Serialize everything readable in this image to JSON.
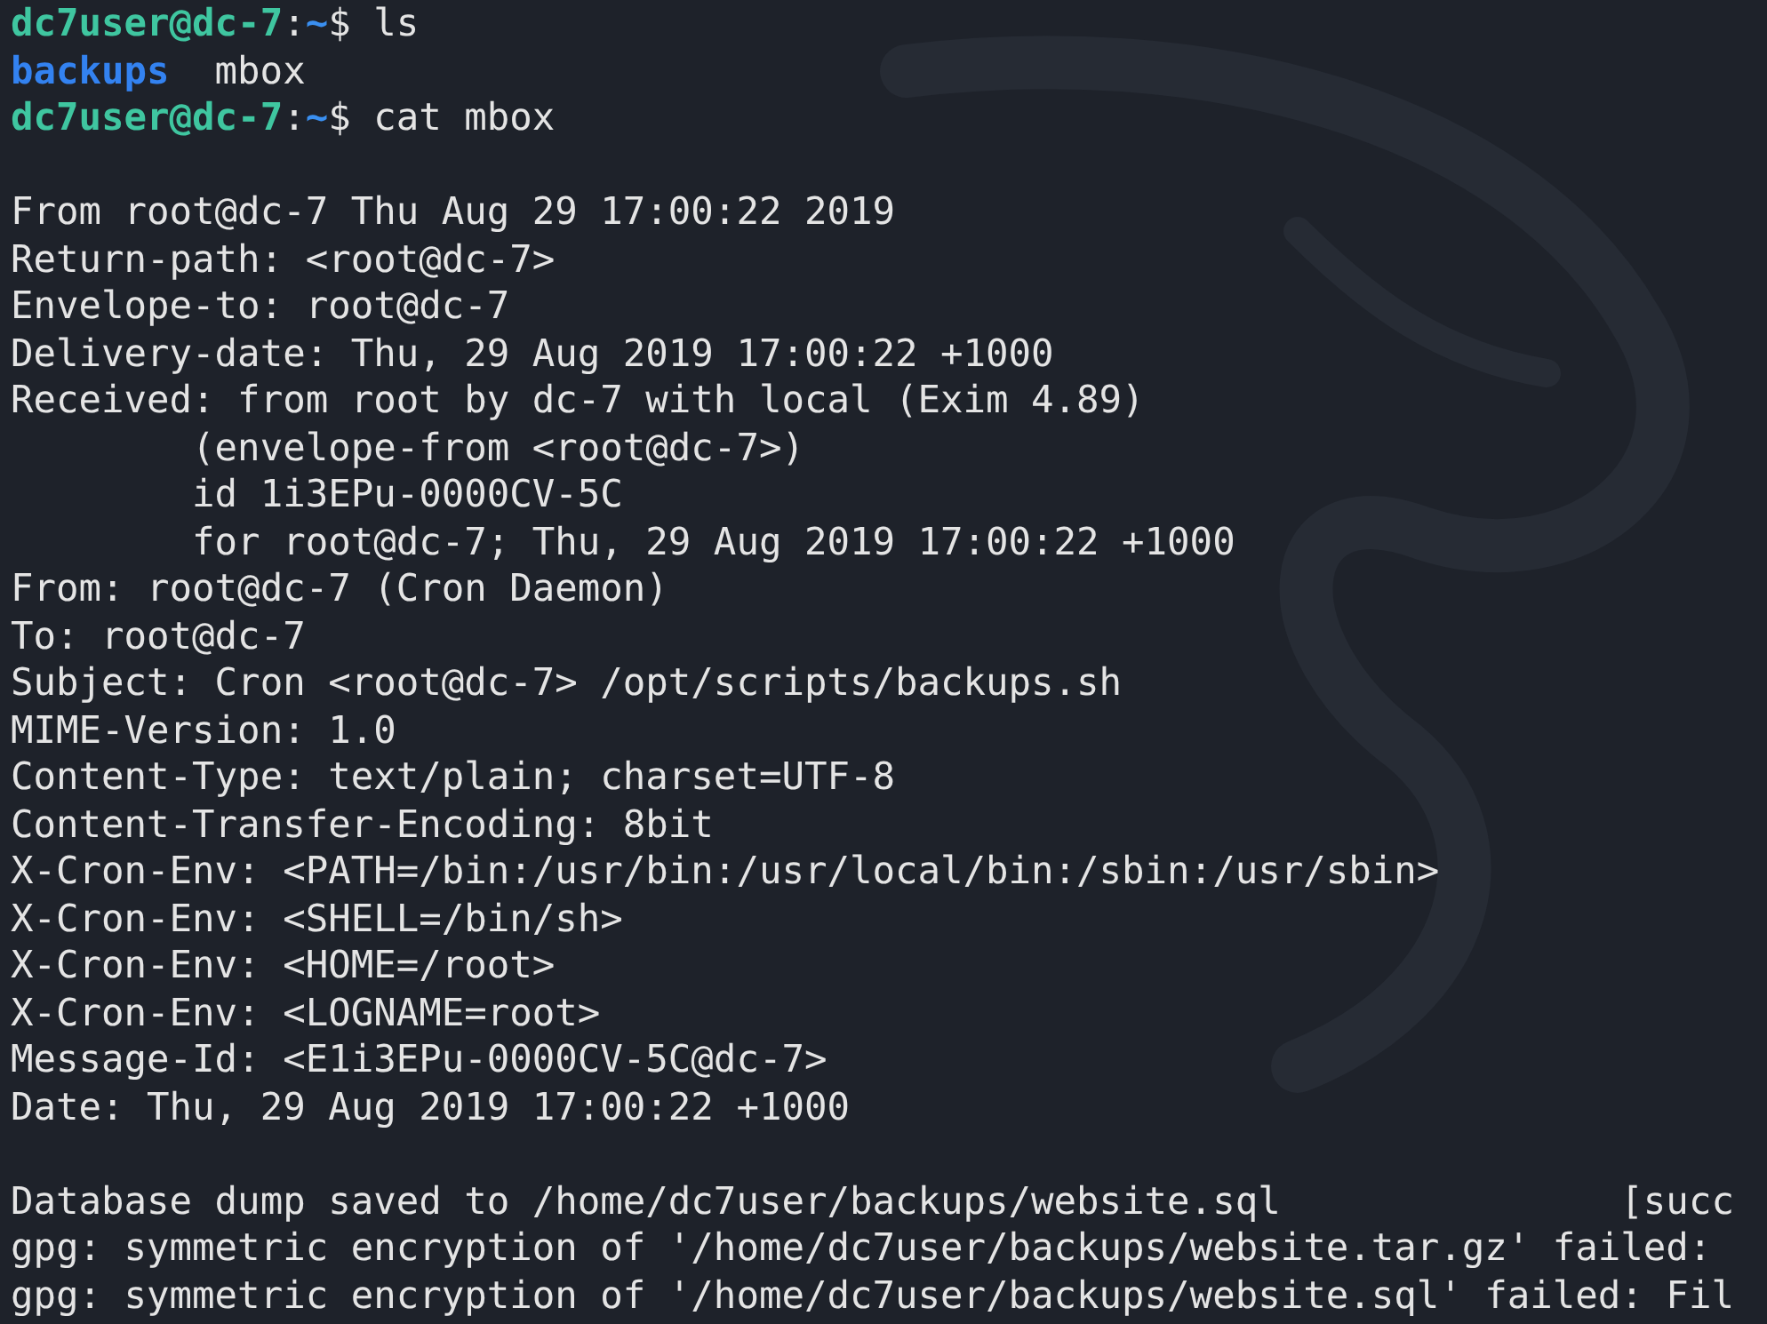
{
  "terminal": {
    "lines": [
      {
        "kind": "prompt",
        "user_host": "dc7user@dc-7",
        "separator": ":",
        "path": "~",
        "symbol": "$",
        "command": "ls"
      },
      {
        "kind": "listing",
        "items": [
          {
            "name": "backups",
            "kind": "dir"
          },
          {
            "name": "mbox",
            "kind": "file"
          }
        ]
      },
      {
        "kind": "prompt",
        "user_host": "dc7user@dc-7",
        "separator": ":",
        "path": "~",
        "symbol": "$",
        "command": "cat mbox"
      },
      {
        "kind": "blank"
      },
      {
        "kind": "text",
        "text": "From root@dc-7 Thu Aug 29 17:00:22 2019"
      },
      {
        "kind": "text",
        "text": "Return-path: <root@dc-7>"
      },
      {
        "kind": "text",
        "text": "Envelope-to: root@dc-7"
      },
      {
        "kind": "text",
        "text": "Delivery-date: Thu, 29 Aug 2019 17:00:22 +1000"
      },
      {
        "kind": "text",
        "text": "Received: from root by dc-7 with local (Exim 4.89)",
        "children": [
          {
            "kind": "text",
            "text": "(envelope-from <root@dc-7>)"
          },
          {
            "kind": "text",
            "text": "id 1i3EPu-0000CV-5C"
          },
          {
            "kind": "text",
            "text": "for root@dc-7; Thu, 29 Aug 2019 17:00:22 +1000"
          }
        ]
      },
      {
        "kind": "text",
        "text": "From: root@dc-7 (Cron Daemon)"
      },
      {
        "kind": "text",
        "text": "To: root@dc-7"
      },
      {
        "kind": "text",
        "text": "Subject: Cron <root@dc-7> /opt/scripts/backups.sh"
      },
      {
        "kind": "text",
        "text": "MIME-Version: 1.0"
      },
      {
        "kind": "text",
        "text": "Content-Type: text/plain; charset=UTF-8"
      },
      {
        "kind": "text",
        "text": "Content-Transfer-Encoding: 8bit"
      },
      {
        "kind": "text",
        "text": "X-Cron-Env: <PATH=/bin:/usr/bin:/usr/local/bin:/sbin:/usr/sbin>"
      },
      {
        "kind": "text",
        "text": "X-Cron-Env: <SHELL=/bin/sh>"
      },
      {
        "kind": "text",
        "text": "X-Cron-Env: <HOME=/root>"
      },
      {
        "kind": "text",
        "text": "X-Cron-Env: <LOGNAME=root>"
      },
      {
        "kind": "text",
        "text": "Message-Id: <E1i3EPu-0000CV-5C@dc-7>"
      },
      {
        "kind": "text",
        "text": "Date: Thu, 29 Aug 2019 17:00:22 +1000"
      },
      {
        "kind": "blank"
      },
      {
        "kind": "status",
        "text": "Database dump saved to /home/dc7user/backups/website.sql",
        "status": "[succ"
      },
      {
        "kind": "text",
        "text": "gpg: symmetric encryption of '/home/dc7user/backups/website.tar.gz' failed:"
      },
      {
        "kind": "text",
        "text": "gpg: symmetric encryption of '/home/dc7user/backups/website.sql' failed: Fil"
      }
    ]
  }
}
